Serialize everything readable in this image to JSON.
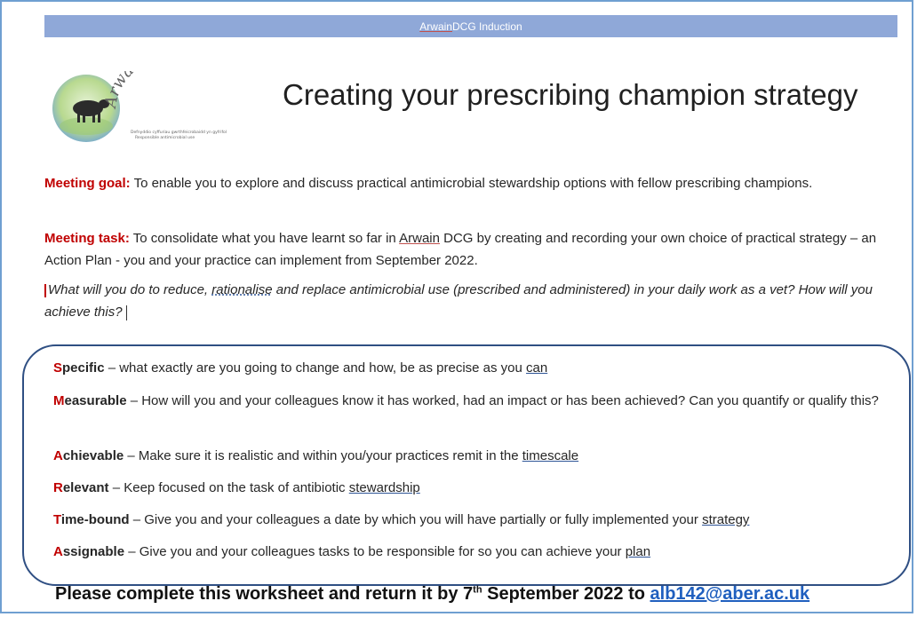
{
  "header": {
    "brand": "Arwain",
    "rest": " DCG Induction"
  },
  "logo": {
    "text": "Arwain DGC",
    "tagline1": "Defnyddio cyffuriau gwrthfeicrobaidd yn gyfrifol",
    "tagline2": "Responsible antimicrobial use",
    "icon": "cattle-in-circle-logo"
  },
  "title": "Creating your prescribing champion strategy",
  "goal": {
    "label": "Meeting goal:",
    "text": " To enable you to explore and discuss practical antimicrobial stewardship options with fellow prescribing champions."
  },
  "task": {
    "label": "Meeting task:",
    "text_before": " To consolidate what you have learnt so far in ",
    "brand": "Arwain",
    "text_after": " DCG by creating and recording your own choice of practical strategy – an Action Plan - you and your practice can implement from September 2022."
  },
  "question": {
    "before": "What will you do to reduce, ",
    "underlined": "rationalise",
    "after": " and replace antimicrobial use (prescribed and administered) in your daily work as a vet? How will you achieve this?"
  },
  "smart": [
    {
      "first": "S",
      "rest": "pecific",
      "text": " – what exactly are you going to change and how, be as precise as you ",
      "link": "can"
    },
    {
      "first": "M",
      "rest": "easurable",
      "text": " – How will you and your colleagues know it has worked, had an impact or has been achieved? Can you quantify or qualify this?",
      "link": ""
    },
    {
      "first": "A",
      "rest": "chievable",
      "text": " – Make sure it is realistic and within you/your practices remit in the ",
      "link": "timescale"
    },
    {
      "first": "R",
      "rest": "elevant",
      "text": " – Keep focused on the task of antibiotic ",
      "link": "stewardship"
    },
    {
      "first": "T",
      "rest": "ime-bound",
      "text": " – Give you and your colleagues a date by which you will have partially or fully implemented your ",
      "link": "strategy"
    },
    {
      "first": "A",
      "rest": "ssignable",
      "text": " – Give you and your colleagues tasks to be responsible for so you can achieve your ",
      "link": "plan"
    }
  ],
  "footer": {
    "before": "Please complete this worksheet and return it by 7",
    "sup": "th",
    "after": " September 2022 to ",
    "email": "alb142@aber.ac.uk"
  },
  "colors": {
    "header_bar": "#8fa8d8",
    "label_red": "#c00000",
    "box_border": "#2f4f83",
    "link_blue": "#1f5fbf"
  }
}
